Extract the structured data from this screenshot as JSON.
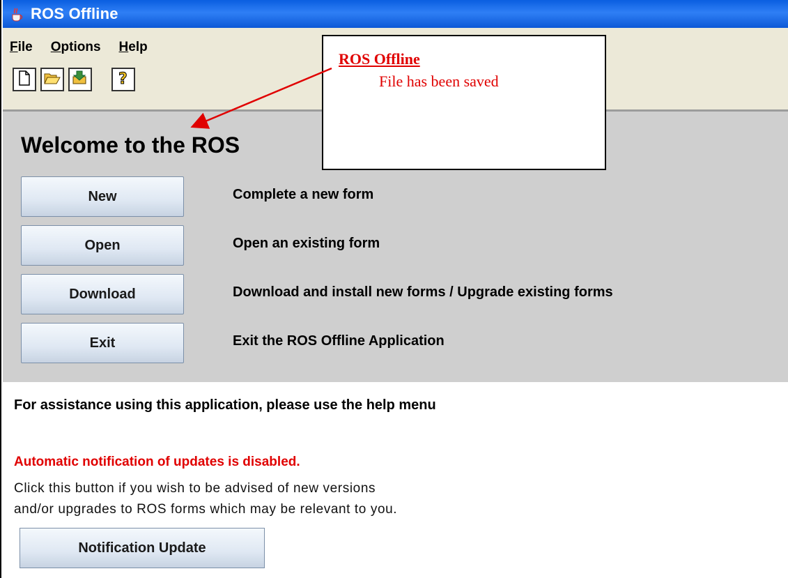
{
  "window": {
    "title": "ROS Offline",
    "icon": "java-cup-icon"
  },
  "menubar": {
    "items": [
      {
        "mnemonic": "F",
        "rest": "ile"
      },
      {
        "mnemonic": "O",
        "rest": "ptions"
      },
      {
        "mnemonic": "H",
        "rest": "elp"
      }
    ]
  },
  "toolbar": {
    "icons": [
      "new-file-icon",
      "open-folder-icon",
      "download-icon",
      "help-icon"
    ]
  },
  "panel": {
    "heading": "Welcome to the ROS",
    "actions": [
      {
        "label": "New",
        "description": "Complete a new form"
      },
      {
        "label": "Open",
        "description": "Open an existing form"
      },
      {
        "label": "Download",
        "description": "Download and install new forms / Upgrade existing forms"
      },
      {
        "label": "Exit",
        "description": "Exit the ROS Offline Application"
      }
    ]
  },
  "footer": {
    "assist_text": "For assistance using this application, please use the help menu",
    "warning": "Automatic notification of updates is disabled.",
    "info_line1": "Click this button if you wish to be advised of new versions",
    "info_line2": "and/or upgrades to ROS forms which may be relevant to you.",
    "notify_button": "Notification Update"
  },
  "callout": {
    "title": "ROS Offline",
    "message": "File has been saved"
  },
  "colors": {
    "titlebar": "#0c58d6",
    "panel": "#cfcfcf",
    "annotation": "#e00000",
    "warning": "#e00000"
  }
}
